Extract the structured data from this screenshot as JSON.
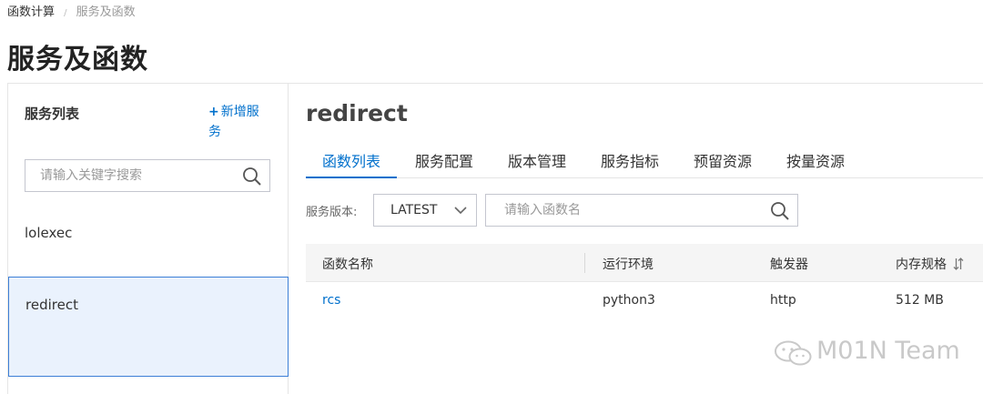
{
  "breadcrumb": {
    "root": "函数计算",
    "separator": "/",
    "current": "服务及函数"
  },
  "page": {
    "title": "服务及函数"
  },
  "sidebar": {
    "title": "服务列表",
    "add_button": "新增服务",
    "add_prefix": "+",
    "search_placeholder": "请输入关键字搜索",
    "items": [
      {
        "label": "lolexec",
        "selected": false
      },
      {
        "label": "redirect",
        "selected": true
      }
    ]
  },
  "main": {
    "service_name": "redirect",
    "tabs": [
      {
        "label": "函数列表",
        "active": true
      },
      {
        "label": "服务配置",
        "active": false
      },
      {
        "label": "版本管理",
        "active": false
      },
      {
        "label": "服务指标",
        "active": false
      },
      {
        "label": "预留资源",
        "active": false
      },
      {
        "label": "按量资源",
        "active": false
      }
    ],
    "version_label": "服务版本:",
    "version_value": "LATEST",
    "function_search_placeholder": "请输入函数名",
    "table": {
      "columns": [
        "函数名称",
        "运行环境",
        "触发器",
        "内存规格"
      ],
      "rows": [
        [
          "rcs",
          "python3",
          "http",
          "512 MB"
        ]
      ]
    }
  },
  "watermark": {
    "text": "M01N Team"
  },
  "colors": {
    "accent": "#0070cc",
    "selected_bg": "#eaf2fd",
    "selected_border": "#3d7fd6"
  }
}
